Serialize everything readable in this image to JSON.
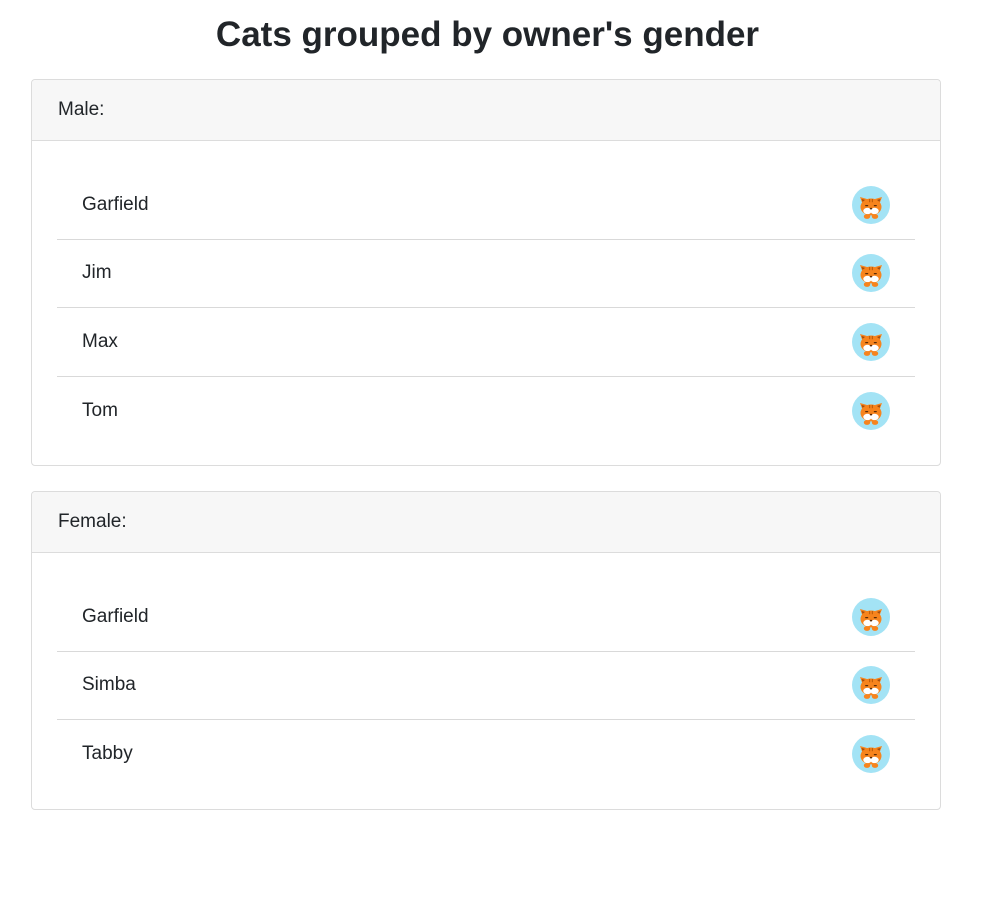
{
  "page": {
    "title": "Cats grouped by owner's gender"
  },
  "groups": [
    {
      "label": "Male:",
      "cats": [
        {
          "name": "Garfield",
          "icon": "cat-face-icon"
        },
        {
          "name": "Jim",
          "icon": "cat-face-icon"
        },
        {
          "name": "Max",
          "icon": "cat-face-icon"
        },
        {
          "name": "Tom",
          "icon": "cat-face-icon"
        }
      ]
    },
    {
      "label": "Female:",
      "cats": [
        {
          "name": "Garfield",
          "icon": "cat-face-icon"
        },
        {
          "name": "Simba",
          "icon": "cat-face-icon"
        },
        {
          "name": "Tabby",
          "icon": "cat-face-icon"
        }
      ]
    }
  ],
  "colors": {
    "avatar_background": "#a3e3f5",
    "cat_fur": "#f7841d",
    "cat_face": "#ffffff",
    "card_header": "#f7f7f7",
    "border": "#dcdcdc"
  }
}
